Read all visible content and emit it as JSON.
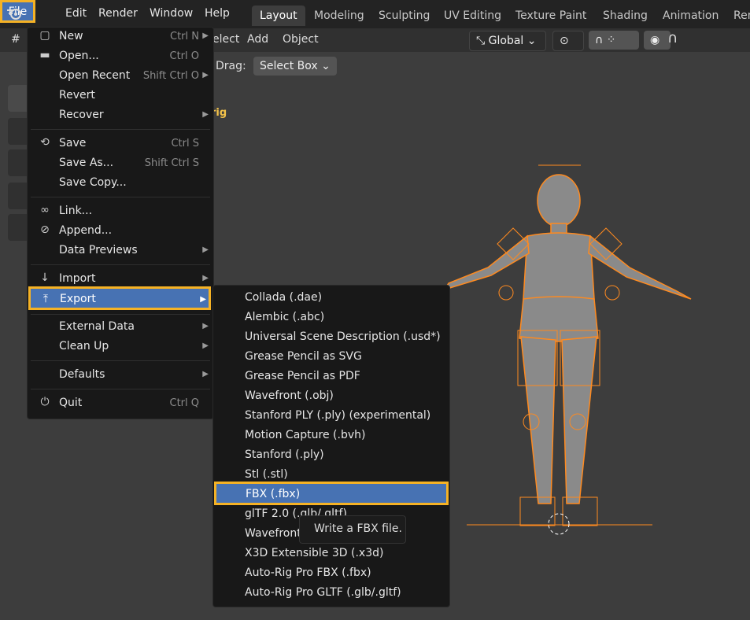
{
  "topbar": {
    "menu": [
      "File",
      "Edit",
      "Render",
      "Window",
      "Help"
    ],
    "workspaces": [
      "Layout",
      "Modeling",
      "Sculpting",
      "UV Editing",
      "Texture Paint",
      "Shading",
      "Animation",
      "Ren"
    ],
    "active_workspace": "Layout"
  },
  "header": {
    "select": "elect",
    "add": "Add",
    "object": "Object",
    "orientation": "Global",
    "drag_label": "Drag:",
    "drag_value": "Select Box"
  },
  "viewport": {
    "rig_label": "rig"
  },
  "file_menu": {
    "items": [
      {
        "label": "New",
        "shortcut": "Ctrl N",
        "icon": "new-file-icon",
        "submenu": true
      },
      {
        "label": "Open...",
        "shortcut": "Ctrl O",
        "icon": "folder-icon"
      },
      {
        "label": "Open Recent",
        "shortcut": "Shift Ctrl O",
        "submenu": true
      },
      {
        "label": "Revert"
      },
      {
        "label": "Recover",
        "submenu": true
      },
      {
        "label": "Save",
        "shortcut": "Ctrl S",
        "icon": "save-icon"
      },
      {
        "label": "Save As...",
        "shortcut": "Shift Ctrl S"
      },
      {
        "label": "Save Copy..."
      },
      {
        "label": "Link...",
        "icon": "link-icon"
      },
      {
        "label": "Append...",
        "icon": "append-icon"
      },
      {
        "label": "Data Previews",
        "submenu": true
      },
      {
        "label": "Import",
        "icon": "import-icon",
        "submenu": true
      },
      {
        "label": "Export",
        "icon": "export-icon",
        "submenu": true
      },
      {
        "label": "External Data",
        "submenu": true
      },
      {
        "label": "Clean Up",
        "submenu": true
      },
      {
        "label": "Defaults",
        "submenu": true
      },
      {
        "label": "Quit",
        "shortcut": "Ctrl Q",
        "icon": "power-icon"
      }
    ]
  },
  "export_menu": {
    "items": [
      "Collada (.dae)",
      "Alembic (.abc)",
      "Universal Scene Description (.usd*)",
      "Grease Pencil as SVG",
      "Grease Pencil as PDF",
      "Wavefront (.obj)",
      "Stanford PLY (.ply) (experimental)",
      "Motion Capture (.bvh)",
      "Stanford (.ply)",
      "Stl (.stl)",
      "FBX (.fbx)",
      "glTF 2.0 (.glb/.gltf)",
      "Wavefront",
      "X3D Extensible 3D (.x3d)",
      "Auto-Rig Pro FBX (.fbx)",
      "Auto-Rig Pro GLTF (.glb/.gltf)"
    ],
    "highlighted": "FBX (.fbx)"
  },
  "tooltip": {
    "text": "Write a FBX file."
  },
  "colors": {
    "highlight": "#4772b3",
    "annotation_border": "#f5b225",
    "menu_bg": "#181818",
    "rig_orange": "#ff8a1f"
  }
}
